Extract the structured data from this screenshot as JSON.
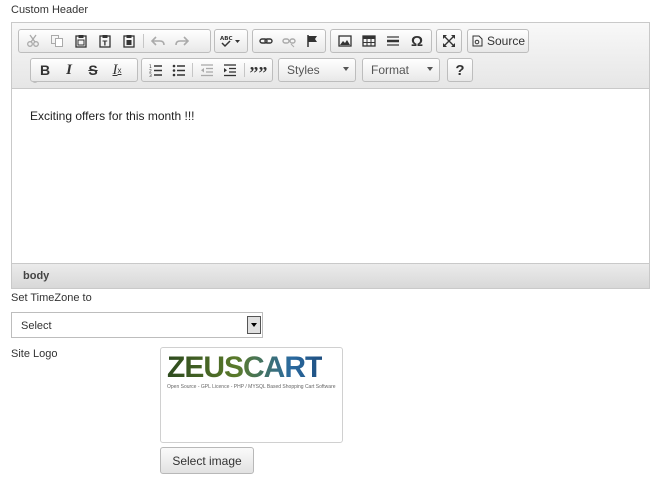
{
  "labels": {
    "custom_header": "Custom Header",
    "timezone": "Set TimeZone to",
    "site_logo": "Site Logo"
  },
  "editor": {
    "toolbar": {
      "styles_label": "Styles",
      "format_label": "Format",
      "source_label": "Source",
      "icons": [
        "cut-icon",
        "copy-icon",
        "paste-icon",
        "paste-text-icon",
        "paste-word-icon",
        "undo-icon",
        "redo-icon",
        "spellcheck-icon",
        "link-icon",
        "unlink-icon",
        "anchor-icon",
        "image-icon",
        "table-icon",
        "horizontal-line-icon",
        "special-char-icon",
        "maximize-icon",
        "source-icon",
        "bold-icon",
        "italic-icon",
        "strike-icon",
        "remove-format-icon",
        "numbered-list-icon",
        "bulleted-list-icon",
        "outdent-icon",
        "indent-icon",
        "blockquote-icon",
        "help-icon"
      ]
    },
    "content": "Exciting offers for this month !!!",
    "path": "body"
  },
  "timezone_select": {
    "value": "Select"
  },
  "logo": {
    "brand": "ZEUSCART",
    "tagline": "Open Source - GPL Licence - PHP / MYSQL Based Shopping Cart Software"
  },
  "select_image_button": "Select image",
  "colors": {
    "logo_green": "#3a5a2a",
    "logo_blue": "#2a6aa0"
  }
}
